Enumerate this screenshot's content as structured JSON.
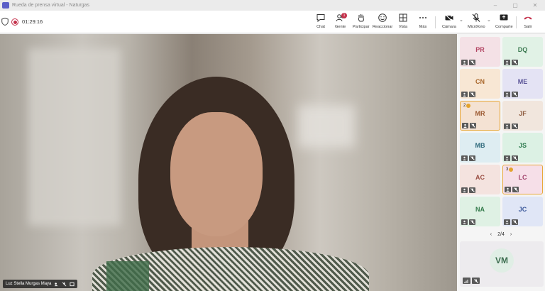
{
  "window": {
    "title": "Rueda de prensa virtual - Naturgas",
    "controls": [
      "–",
      "▢",
      "✕"
    ]
  },
  "toolbar": {
    "timer": "01:29:16",
    "chat": "Chat",
    "people": "Gente",
    "people_badge": "1",
    "raise": "Participar",
    "react": "Reaccionar",
    "view": "Vista",
    "more": "Más",
    "camera": "Cámara",
    "mic": "Micrófono",
    "share": "Comparte",
    "leave": "Salir"
  },
  "main": {
    "speaker_name": "Luz Stella Murgas Maya"
  },
  "participants": [
    {
      "initials": "PR",
      "bg": "#f4e1e6",
      "fg": "#b24462"
    },
    {
      "initials": "DQ",
      "bg": "#e1f2e6",
      "fg": "#3d7a52"
    },
    {
      "initials": "CN",
      "bg": "#f8e7d4",
      "fg": "#a8662a"
    },
    {
      "initials": "ME",
      "bg": "#e4e3f4",
      "fg": "#5a5497"
    },
    {
      "initials": "MR",
      "bg": "#f4e2d3",
      "fg": "#9c5a32",
      "order": "2"
    },
    {
      "initials": "JF",
      "bg": "#f1e6dd",
      "fg": "#8f5d41"
    },
    {
      "initials": "MB",
      "bg": "#deedf2",
      "fg": "#2f6a7c"
    },
    {
      "initials": "JS",
      "bg": "#dcf1e4",
      "fg": "#2e7a4e"
    },
    {
      "initials": "AC",
      "bg": "#f4e3df",
      "fg": "#9b4f44"
    },
    {
      "initials": "LC",
      "bg": "#f6dfe8",
      "fg": "#a2456d",
      "order": "3"
    },
    {
      "initials": "NA",
      "bg": "#dff1e4",
      "fg": "#337a4a"
    },
    {
      "initials": "JC",
      "bg": "#e0e6f6",
      "fg": "#3f5b9c"
    }
  ],
  "pager": {
    "label": "2/4"
  },
  "self_tile": {
    "initials": "VM",
    "bg": "#e0eee5",
    "fg": "#3d6e50"
  }
}
